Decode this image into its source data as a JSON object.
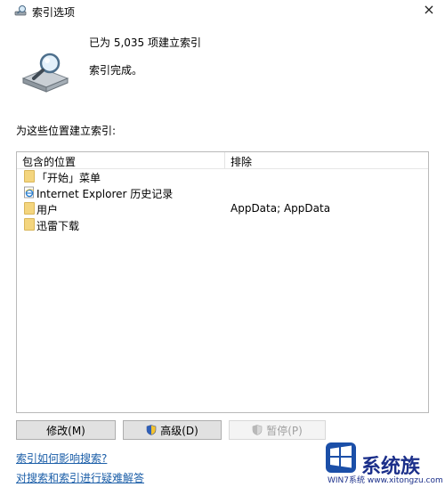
{
  "window": {
    "title": "索引选项",
    "close_symbol": "×"
  },
  "status": {
    "count_text": "已为 5,035 项建立索引",
    "state_text": "索引完成。"
  },
  "locations": {
    "label": "为这些位置建立索引:",
    "columns": [
      "包含的位置",
      "排除"
    ],
    "rows": [
      {
        "icon": "folder-icon",
        "name": "「开始」菜单",
        "exclude": ""
      },
      {
        "icon": "internet-explorer-icon",
        "name": "Internet Explorer 历史记录",
        "exclude": ""
      },
      {
        "icon": "folder-icon",
        "name": "用户",
        "exclude": "AppData; AppData"
      },
      {
        "icon": "folder-icon",
        "name": "迅雷下载",
        "exclude": ""
      }
    ]
  },
  "buttons": {
    "modify": "修改(M)",
    "advanced": "高级(D)",
    "pause": "暂停(P)"
  },
  "links": {
    "help_search": "索引如何影响搜索?",
    "troubleshoot": "对搜索和索引进行疑难解答"
  },
  "watermark": {
    "brand": "系统族",
    "url": "WIN7系统 www.xitongzu.com"
  },
  "colors": {
    "link": "#1b5ea8",
    "folder": "#f4d57e",
    "watermark": "#1b2f8a"
  }
}
